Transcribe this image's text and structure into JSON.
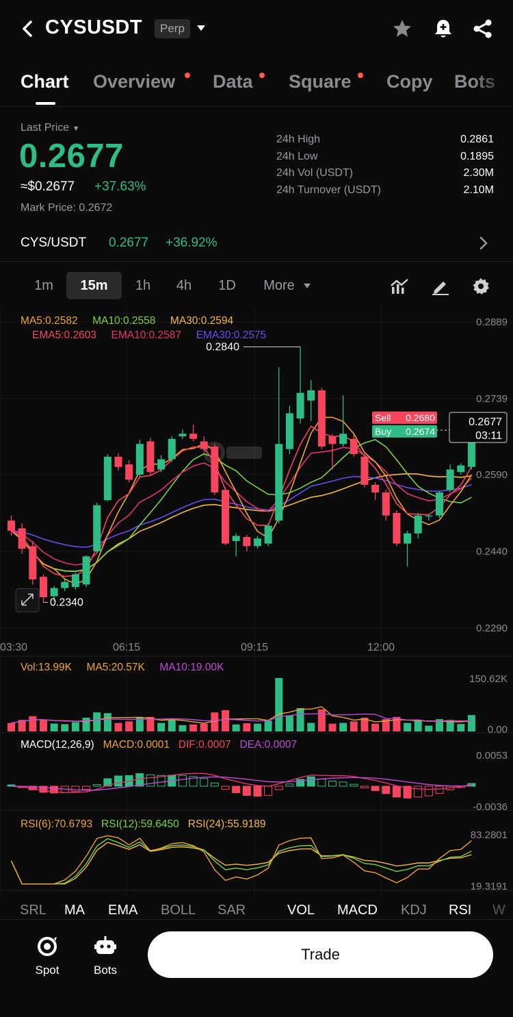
{
  "header": {
    "symbol": "CYSUSDT",
    "badge": "Perp"
  },
  "tabs": [
    {
      "label": "Chart",
      "active": true,
      "dot": false
    },
    {
      "label": "Overview",
      "active": false,
      "dot": true
    },
    {
      "label": "Data",
      "active": false,
      "dot": true
    },
    {
      "label": "Square",
      "active": false,
      "dot": true
    },
    {
      "label": "Copy",
      "active": false,
      "dot": false
    },
    {
      "label": "Bots",
      "active": false,
      "dot": false
    }
  ],
  "price": {
    "last_price_label": "Last Price",
    "last_price": "0.2677",
    "usd_equiv": "≈$0.2677",
    "change_pct": "+37.63%",
    "mark_price": "Mark Price:  0.2672"
  },
  "stats": [
    {
      "label": "24h High",
      "value": "0.2861"
    },
    {
      "label": "24h Low",
      "value": "0.1895"
    },
    {
      "label": "24h Vol (USDT)",
      "value": "2.30M"
    },
    {
      "label": "24h Turnover (USDT)",
      "value": "2.10M"
    }
  ],
  "spot": {
    "pair": "CYS/USDT",
    "price": "0.2677",
    "change": "+36.92%"
  },
  "intervals": [
    "1m",
    "15m",
    "1h",
    "4h",
    "1D",
    "More"
  ],
  "active_interval": "15m",
  "colors": {
    "up": "#2ebd85",
    "down": "#f6465d",
    "ma5": "#f0a431",
    "ma10": "#7cd341",
    "ma30": "#f7b942",
    "ema5": "#f6465d",
    "ema10": "#e8336e",
    "ema30": "#6a4bf0",
    "purple": "#c04ad8"
  },
  "chart_data": {
    "type": "candlestick",
    "ma_legend": [
      "MA5:0.2582",
      "MA10:0.2558",
      "MA30:0.2594"
    ],
    "ema_legend": [
      "EMA5:0.2603",
      "EMA10:0.2587",
      "EMA30:0.2575"
    ],
    "y_ticks": [
      "0.2889",
      "0.2739",
      "0.2590",
      "0.2440",
      "0.2290"
    ],
    "x_ticks": [
      "03:30",
      "06:15",
      "09:15",
      "12:00"
    ],
    "high_label": "0.2840",
    "low_label": "0.2340",
    "sell_label": "Sell",
    "sell_price": "0.2680",
    "buy_label": "Buy",
    "buy_price": "0.2674",
    "current_price": "0.2677",
    "countdown": "03:11",
    "ylim": [
      0.2275,
      0.2905
    ],
    "candles": [
      [
        0.25,
        0.248,
        0.251,
        0.247
      ],
      [
        0.2485,
        0.2445,
        0.2495,
        0.2435
      ],
      [
        0.245,
        0.2385,
        0.246,
        0.2375
      ],
      [
        0.239,
        0.235,
        0.2395,
        0.234
      ],
      [
        0.2352,
        0.2368,
        0.2372,
        0.2342
      ],
      [
        0.2368,
        0.238,
        0.2385,
        0.2362
      ],
      [
        0.237,
        0.2395,
        0.2398,
        0.2365
      ],
      [
        0.2375,
        0.243,
        0.2432,
        0.237
      ],
      [
        0.244,
        0.253,
        0.2535,
        0.2435
      ],
      [
        0.254,
        0.2625,
        0.263,
        0.2538
      ],
      [
        0.2625,
        0.2605,
        0.2632,
        0.2598
      ],
      [
        0.261,
        0.258,
        0.2618,
        0.2575
      ],
      [
        0.259,
        0.265,
        0.2658,
        0.2585
      ],
      [
        0.2655,
        0.2595,
        0.2662,
        0.259
      ],
      [
        0.26,
        0.262,
        0.2628,
        0.2595
      ],
      [
        0.262,
        0.266,
        0.2665,
        0.2615
      ],
      [
        0.2665,
        0.267,
        0.2678,
        0.266
      ],
      [
        0.267,
        0.266,
        0.2688,
        0.2655
      ],
      [
        0.2655,
        0.264,
        0.2665,
        0.2635
      ],
      [
        0.2645,
        0.2555,
        0.265,
        0.255
      ],
      [
        0.256,
        0.2455,
        0.2565,
        0.2452
      ],
      [
        0.246,
        0.247,
        0.2475,
        0.243
      ],
      [
        0.2468,
        0.245,
        0.2472,
        0.244
      ],
      [
        0.245,
        0.2465,
        0.247,
        0.2445
      ],
      [
        0.2455,
        0.249,
        0.2495,
        0.245
      ],
      [
        0.25,
        0.265,
        0.28,
        0.2495
      ],
      [
        0.264,
        0.271,
        0.2725,
        0.263
      ],
      [
        0.27,
        0.275,
        0.284,
        0.269
      ],
      [
        0.2735,
        0.2755,
        0.2775,
        0.2695
      ],
      [
        0.2755,
        0.2645,
        0.276,
        0.264
      ],
      [
        0.2665,
        0.265,
        0.267,
        0.26
      ],
      [
        0.265,
        0.267,
        0.2745,
        0.2645
      ],
      [
        0.266,
        0.263,
        0.2668,
        0.2625
      ],
      [
        0.2625,
        0.257,
        0.263,
        0.2565
      ],
      [
        0.257,
        0.2555,
        0.2575,
        0.254
      ],
      [
        0.2555,
        0.251,
        0.256,
        0.25
      ],
      [
        0.2515,
        0.2455,
        0.252,
        0.245
      ],
      [
        0.2455,
        0.2475,
        0.248,
        0.241
      ],
      [
        0.2475,
        0.251,
        0.2515,
        0.2465
      ],
      [
        0.2508,
        0.251,
        0.2512,
        0.25
      ],
      [
        0.251,
        0.2555,
        0.2558,
        0.2505
      ],
      [
        0.256,
        0.26,
        0.261,
        0.2555
      ],
      [
        0.2595,
        0.2608,
        0.2612,
        0.259
      ],
      [
        0.2605,
        0.2677,
        0.269,
        0.26
      ]
    ],
    "volume": {
      "legend": [
        "Vol:13.99K",
        "MA5:20.57K",
        "MA10:19.00K"
      ],
      "max_label": "150.62K",
      "min_label": "0.00"
    },
    "macd": {
      "legend": [
        "MACD(12,26,9)",
        "MACD:0.0001",
        "DIF:0.0007",
        "DEA:0.0007"
      ],
      "max_label": "0.0053",
      "min_label": "-0.0036"
    },
    "rsi": {
      "legend": [
        "RSI(6):70.6793",
        "RSI(12):59.6450",
        "RSI(24):55.9189"
      ],
      "max_label": "83.2801",
      "min_label": "19.3191"
    }
  },
  "indicators": [
    {
      "label": "SRL",
      "on": false
    },
    {
      "label": "MA",
      "on": true
    },
    {
      "label": "EMA",
      "on": true
    },
    {
      "label": "BOLL",
      "on": false
    },
    {
      "label": "SAR",
      "on": false
    },
    {
      "label": "VOL",
      "on": true
    },
    {
      "label": "MACD",
      "on": true
    },
    {
      "label": "KDJ",
      "on": false
    },
    {
      "label": "RSI",
      "on": true
    },
    {
      "label": "W",
      "on": false
    }
  ],
  "bottom": {
    "spot_label": "Spot",
    "bots_label": "Bots",
    "trade_label": "Trade"
  }
}
